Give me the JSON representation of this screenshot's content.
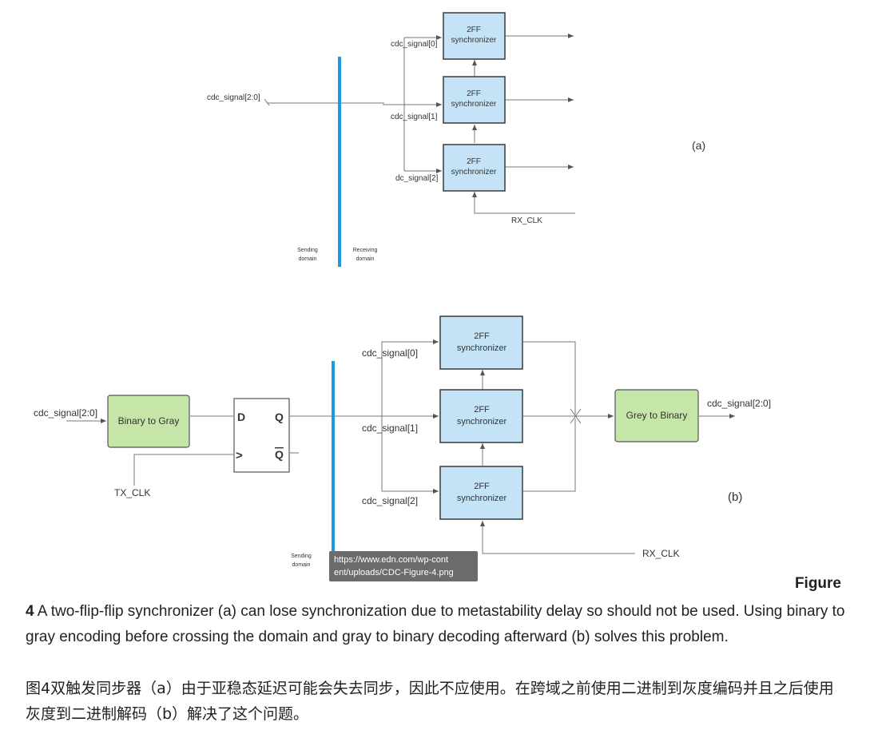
{
  "diagram_a": {
    "input_label": "cdc_signal[2:0]",
    "branch_labels": [
      "cdc_signal[0]",
      "cdc_signal[1]",
      "dc_signal[2]"
    ],
    "sync_label_line1": "2FF",
    "sync_label_line2": "synchronizer",
    "clock_label": "RX_CLK",
    "domain_sending_line1": "Sending",
    "domain_sending_line2": "domain",
    "domain_receiving_line1": "Receiving",
    "domain_receiving_line2": "domain",
    "panel_label": "(a)"
  },
  "diagram_b": {
    "input_label": "cdc_signal[2:0]",
    "encoder_label": "Binary to Gray",
    "ff_d": "D",
    "ff_q": "Q",
    "ff_qbar": "Q",
    "ff_clk": ">",
    "tx_clock_label": "TX_CLK",
    "branch_labels": [
      "cdc_signal[0]",
      "cdc_signal[1]",
      "cdc_signal[2]"
    ],
    "sync_label_line1": "2FF",
    "sync_label_line2": "synchronizer",
    "decoder_label": "Grey to Binary",
    "output_label": "cdc_signal[2:0]",
    "rx_clock_label": "RX_CLK",
    "domain_sending_line1": "Sending",
    "domain_sending_line2": "domain",
    "panel_label": "(b)"
  },
  "colors": {
    "sync_fill": "#c5e3f6",
    "sync_stroke": "#3a3a3a",
    "green_fill": "#c6e5a8",
    "domain_line": "#1a9be0",
    "wire": "#777777"
  },
  "tooltip": {
    "line1": "https://www.edn.com/wp-cont",
    "line2": "ent/uploads/CDC-Figure-4.png"
  },
  "caption": {
    "heading": "Figure",
    "number": "4",
    "text": " A two-flip-flip synchronizer (a) can lose synchronization due to metastability delay so should not be used. Using binary to gray encoding before crossing the domain and gray to binary decoding afterward (b) solves this problem.",
    "chinese": "图4双触发同步器（a）由于亚稳态延迟可能会失去同步，因此不应使用。在跨域之前使用二进制到灰度编码并且之后使用灰度到二进制解码（b）解决了这个问题。"
  }
}
